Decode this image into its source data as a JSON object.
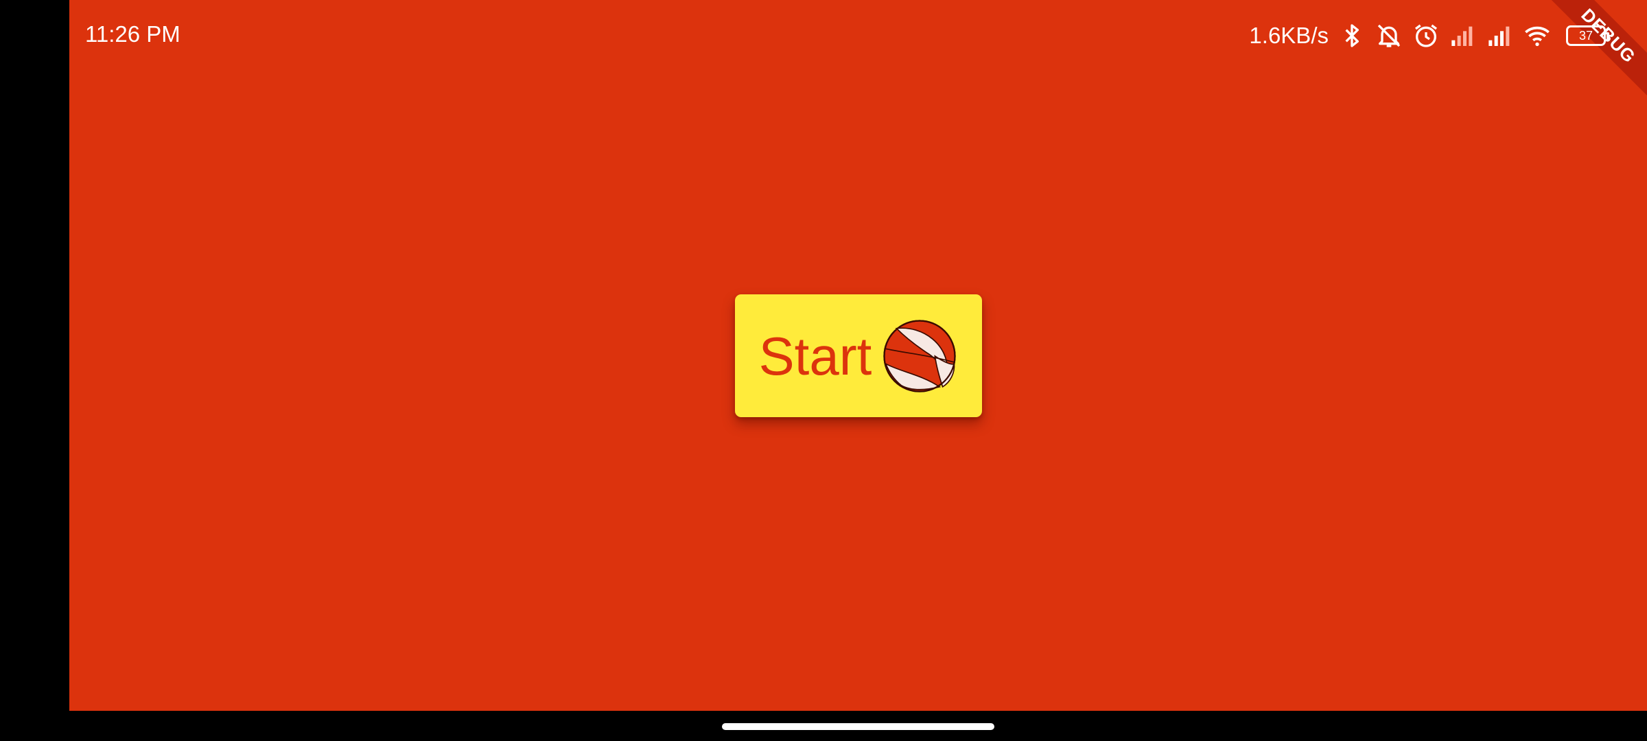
{
  "status_bar": {
    "time": "11:26 PM",
    "net_speed": "1.6KB/s",
    "battery_level": "37",
    "icons": [
      "bluetooth-icon",
      "mute-icon",
      "alarm-icon",
      "signal-icon",
      "signal-icon",
      "wifi-icon",
      "battery-icon"
    ]
  },
  "debug_banner": {
    "label": "DEBUG"
  },
  "main": {
    "start_label": "Start",
    "icon": "basketball-icon"
  },
  "colors": {
    "background": "#dc330d",
    "button": "#ffeb3b",
    "button_text": "#dc330d"
  }
}
